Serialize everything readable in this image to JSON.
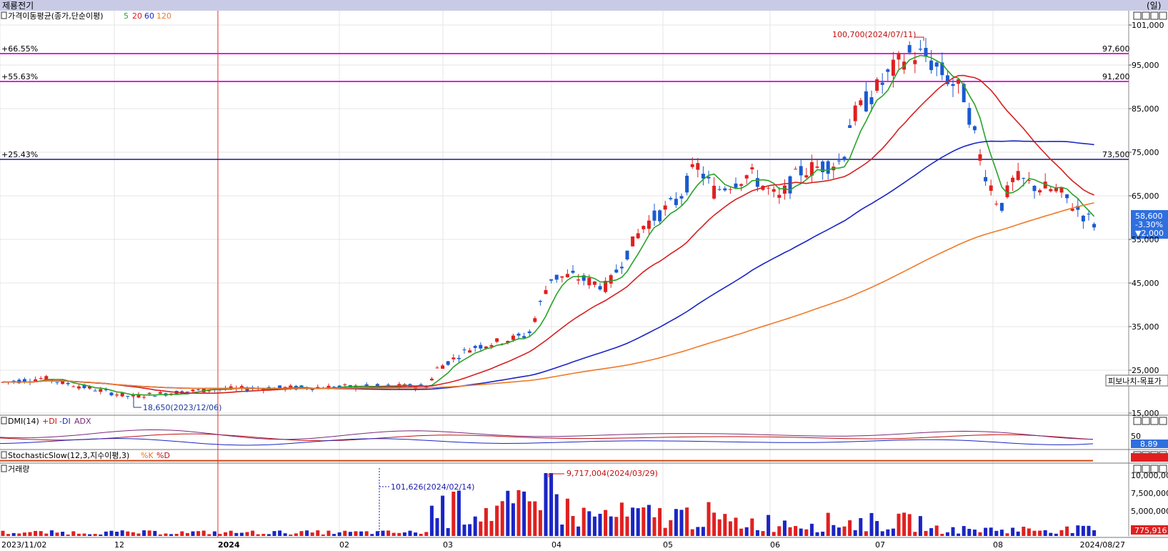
{
  "header": {
    "company": "제룡전기",
    "right_label": "(일)"
  },
  "panel_price": {
    "title": "가격이동평균(종가,단순이평)",
    "ma_labels": [
      "5",
      "20",
      "60",
      "120"
    ],
    "ma_colors": [
      "#2aa22a",
      "#d62020",
      "#1a25c4",
      "#f07a28"
    ]
  },
  "panel_dmi": {
    "title": "DMI(14)",
    "legend": [
      "+DI",
      "-DI",
      "ADX"
    ],
    "value": "8.89",
    "tick": "50"
  },
  "panel_stoch": {
    "title": "StochasticSlow(12,3,지수이평,3)",
    "legend": [
      "%K",
      "%D"
    ]
  },
  "panel_volume": {
    "title": "거래량",
    "value": "775,916",
    "annotations": {
      "max": "9,717,004(2024/03/29)",
      "min": "101,626(2024/02/14)"
    }
  },
  "annotations": {
    "high": "100,700(2024/07/11)",
    "low": "18,650(2023/12/06)",
    "fib_label": "피보나치-목표가"
  },
  "price_box": {
    "price": "58,600",
    "change_pct": "-3.30%",
    "change": "▼2,000"
  },
  "hlines": [
    {
      "left": "+66.55%",
      "right": "97,600",
      "color": "#e020e0"
    },
    {
      "left": "+55.63%",
      "right": "91,200",
      "color": "#e020e0"
    },
    {
      "left": "+25.43%",
      "right": "73,500",
      "color": "#1a1a80"
    }
  ],
  "chart_data": {
    "type": "candlestick",
    "price_axis_ticks": [
      "101,000",
      "95,000",
      "85,000",
      "75,000",
      "65,000",
      "55,000",
      "45,000",
      "35,000",
      "25,000",
      "15,000"
    ],
    "volume_axis_ticks": [
      "10,000,000",
      "7,500,000",
      "5,000,000",
      "2,500,000"
    ],
    "x_tick_labels": [
      "2023/11/02",
      "12",
      "2024",
      "02",
      "03",
      "04",
      "05",
      "06",
      "07",
      "08",
      "2024/08/27"
    ],
    "ohlc_approx": [
      {
        "date": "2023/11/02",
        "close": 22000
      },
      {
        "date": "2023/12/06",
        "low": 18650
      },
      {
        "date": "2024/01/02",
        "close": 21000
      },
      {
        "date": "2024/02/14",
        "close": 21000
      },
      {
        "date": "2024/03/04",
        "close": 27000
      },
      {
        "date": "2024/03/29",
        "close": 46000
      },
      {
        "date": "2024/05/02",
        "close": 65000
      },
      {
        "date": "2024/06/03",
        "close": 72000
      },
      {
        "date": "2024/07/01",
        "close": 90000
      },
      {
        "date": "2024/07/11",
        "high": 100700
      },
      {
        "date": "2024/08/01",
        "close": 80000
      },
      {
        "date": "2024/08/27",
        "close": 58600
      }
    ]
  }
}
